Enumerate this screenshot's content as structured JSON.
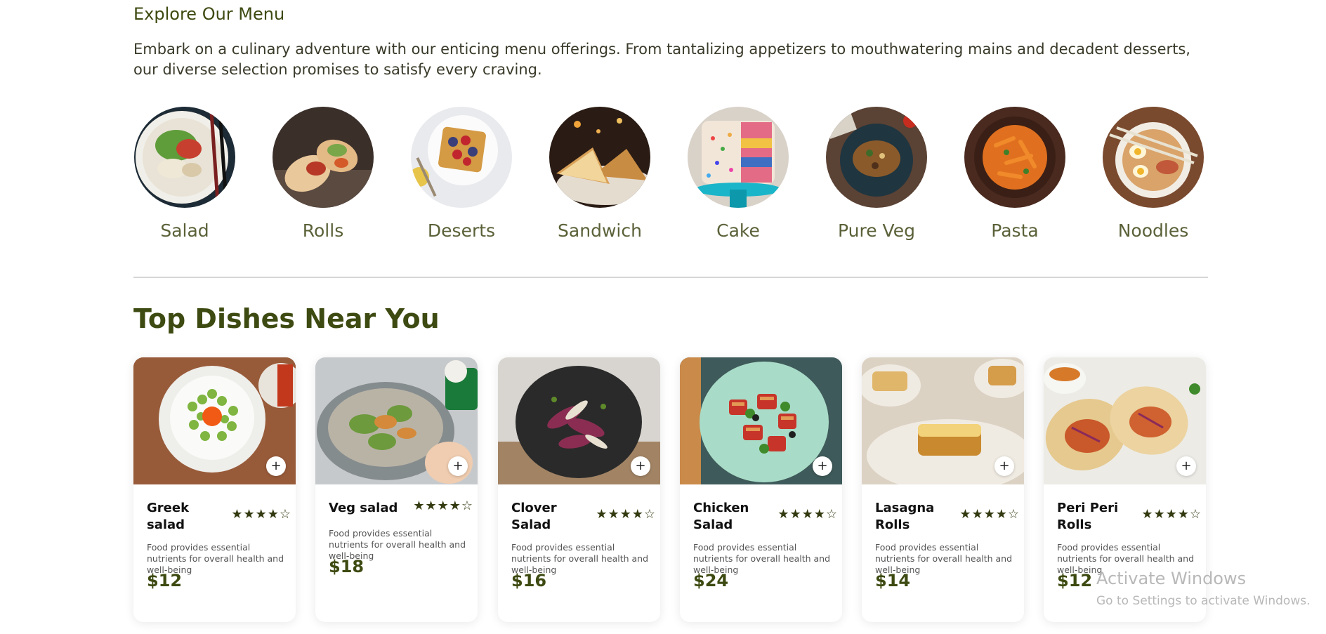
{
  "explore": {
    "title": "Explore Our Menu",
    "description": "Embark on a culinary adventure with our enticing menu offerings. From tantalizing appetizers to mouthwatering mains and decadent desserts, our diverse selection promises to satisfy every craving."
  },
  "categories": [
    {
      "label": "Salad"
    },
    {
      "label": "Rolls"
    },
    {
      "label": "Deserts"
    },
    {
      "label": "Sandwich"
    },
    {
      "label": "Cake"
    },
    {
      "label": "Pure Veg"
    },
    {
      "label": "Pasta"
    },
    {
      "label": "Noodles"
    }
  ],
  "top_dishes": {
    "title": "Top Dishes Near You",
    "items": [
      {
        "name": "Greek salad",
        "rating": "★★★★☆",
        "description": "Food provides essential nutrients for overall health and well-being",
        "price": "$12",
        "add": "+"
      },
      {
        "name": "Veg salad",
        "rating": "★★★★☆",
        "description": "Food provides essential nutrients for overall health and well-being",
        "price": "$18",
        "add": "+"
      },
      {
        "name": "Clover Salad",
        "rating": "★★★★☆",
        "description": "Food provides essential nutrients for overall health and well-being",
        "price": "$16",
        "add": "+"
      },
      {
        "name": "Chicken Salad",
        "rating": "★★★★☆",
        "description": "Food provides essential nutrients for overall health and well-being",
        "price": "$24",
        "add": "+"
      },
      {
        "name": "Lasagna Rolls",
        "rating": "★★★★☆",
        "description": "Food provides essential nutrients for overall health and well-being",
        "price": "$14",
        "add": "+"
      },
      {
        "name": "Peri Peri Rolls",
        "rating": "★★★★☆",
        "description": "Food provides essential nutrients for overall health and well-being",
        "price": "$12",
        "add": "+"
      }
    ]
  },
  "watermark": {
    "line1": "Activate Windows",
    "line2": "Go to Settings to activate Windows."
  }
}
